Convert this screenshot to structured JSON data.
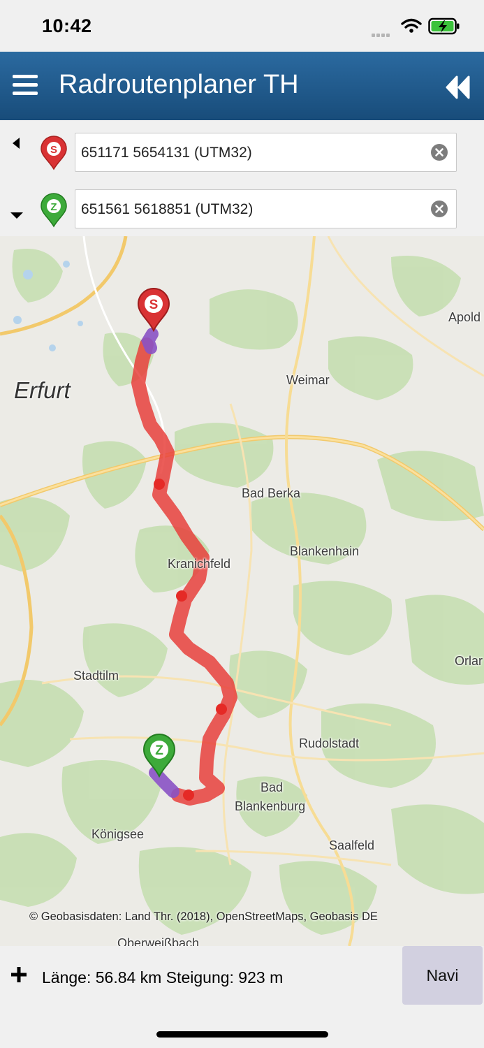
{
  "status_bar": {
    "time": "10:42"
  },
  "header": {
    "title": "Radroutenplaner TH",
    "menu_icon": "hamburger-icon",
    "collapse_icon": "double-chevron-left-icon"
  },
  "route": {
    "start": {
      "pin_letter": "S",
      "value": "651171 5654131 (UTM32)",
      "color": "#d93234"
    },
    "end": {
      "pin_letter": "Z",
      "value": "651561 5618851 (UTM32)",
      "color": "#3daa3a"
    }
  },
  "map": {
    "places": {
      "erfurt": "Erfurt",
      "weimar": "Weimar",
      "apolda": "Apold",
      "bad_berka": "Bad Berka",
      "blankenhain": "Blankenhain",
      "kranichfeld": "Kranichfeld",
      "stadtilm": "Stadtilm",
      "orlamuende": "Orlar",
      "rudolstadt": "Rudolstadt",
      "bad": "Bad",
      "blankenburg": "Blankenburg",
      "koenigsee": "Königsee",
      "saalfeld": "Saalfeld",
      "oberweissbach": "Oberweißbach"
    },
    "attribution": "© Geobasisdaten: Land Thr. (2018), OpenStreetMaps, Geobasis DE",
    "route_color": "#e8413c"
  },
  "footer": {
    "route_info": "Länge: 56.84 km Steigung: 923 m",
    "navi_label": "Navi"
  }
}
